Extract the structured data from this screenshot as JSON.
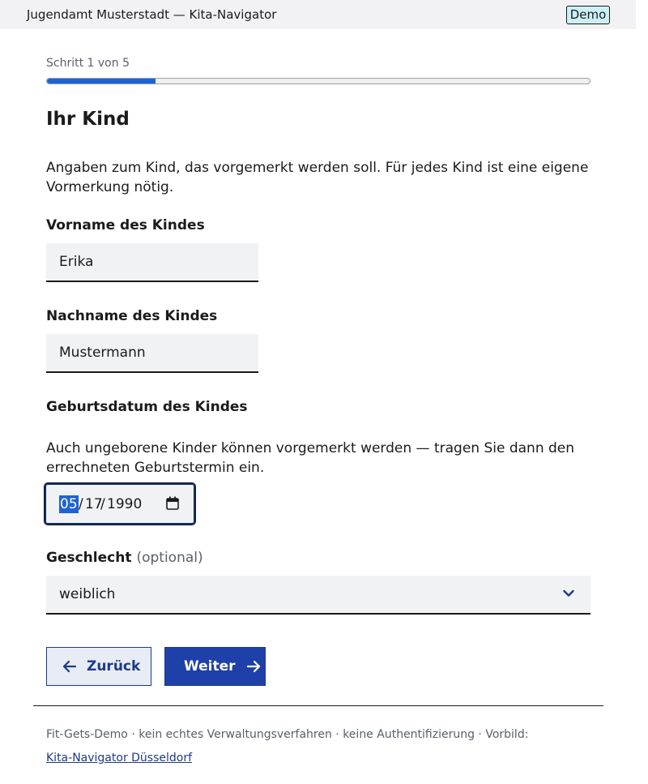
{
  "header": {
    "title": "Jugendamt Musterstadt — Kita-Navigator",
    "badge": "Demo"
  },
  "progress": {
    "step_text": "Schritt 1 von 5",
    "fraction": 0.2
  },
  "page": {
    "heading": "Ihr Kind",
    "intro": "Angaben zum Kind, das vorgemerkt werden soll. Für jedes Kind ist eine eigene Vormerkung nötig."
  },
  "fields": {
    "first_name": {
      "label": "Vorname des Kindes",
      "value": "Erika"
    },
    "last_name": {
      "label": "Nachname des Kindes",
      "value": "Mustermann"
    },
    "birthdate": {
      "label": "Geburtsdatum des Kindes",
      "hint": "Auch ungeborene Kinder können vorgemerkt werden — tragen Sie dann den errechneten Geburtstermin ein.",
      "month": "05",
      "day": "17",
      "year": "1990",
      "separator": "/"
    },
    "gender": {
      "label": "Geschlecht",
      "optional": "(optional)",
      "value": "weiblich"
    }
  },
  "buttons": {
    "back": "Zurück",
    "next": "Weiter"
  },
  "footer": {
    "text": "Fit-Gets-Demo · kein echtes Verwaltungsverfahren · keine Authentifizierung · Vorbild:",
    "link": "Kita-Navigator Düsseldorf"
  },
  "colors": {
    "primary": "#1e40a8",
    "progress": "#1e63d6",
    "badge_bg": "#cdeff6"
  },
  "icons": {
    "back": "arrow-left-icon",
    "next": "arrow-right-icon",
    "calendar": "calendar-icon",
    "select": "chevron-down-icon"
  }
}
